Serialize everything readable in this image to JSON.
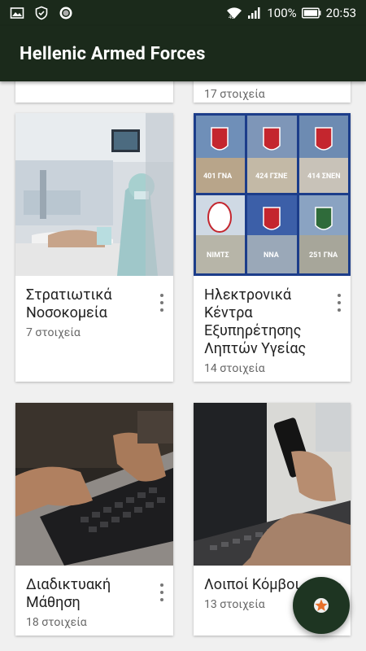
{
  "status_bar": {
    "battery_percent": "100%",
    "time": "20:53",
    "left_icons": [
      "image-icon",
      "shield-icon",
      "circle-icon"
    ],
    "right_icons": [
      "wifi-icon",
      "signal-icon",
      "battery-icon"
    ]
  },
  "app_bar": {
    "title": "Hellenic Armed Forces",
    "background": "#1b2a1b"
  },
  "partial_top_row": {
    "right_count": "17 στοιχεία"
  },
  "cards": [
    {
      "title": "Στρατιωτικά Νοσοκομεία",
      "title_lines": [
        "Στρατιωτικά",
        "Νοσοκομεία"
      ],
      "count": "7 στοιχεία",
      "image": "hospital-room-image"
    },
    {
      "title": "Ηλεκτρονικά Κέντρα Εξυπηρέτησης Ληπτών Υγείας",
      "title_lines": [
        "Ηλεκτρονικά",
        "Κέντρα",
        "Εξυπηρέτησης",
        "Ληπτών Υγείας"
      ],
      "count": "14 στοιχεία",
      "image": "hospitals-collage-image",
      "collage_labels": [
        "401 ΓΝΑ",
        "424 ΓΣΝΕ",
        "414 ΣΝΕΝ",
        "ΝΙΜΤΣ",
        "ΝΝΑ",
        "251 ΓΝΑ"
      ]
    },
    {
      "title": "Διαδικτυακή Μάθηση",
      "title_lines": [
        "Διαδικτυακή",
        "Μάθηση"
      ],
      "count": "18 στοιχεία",
      "image": "laptop-typing-image"
    },
    {
      "title": "Λοιποί Κόμβοι",
      "title_lines": [
        "Λοιποί Κόμβοι"
      ],
      "count": "13 στοιχεία",
      "image": "phone-laptop-image"
    }
  ],
  "fab": {
    "icon": "star-icon",
    "background": "#1e3522",
    "accent": "#e8702a"
  }
}
